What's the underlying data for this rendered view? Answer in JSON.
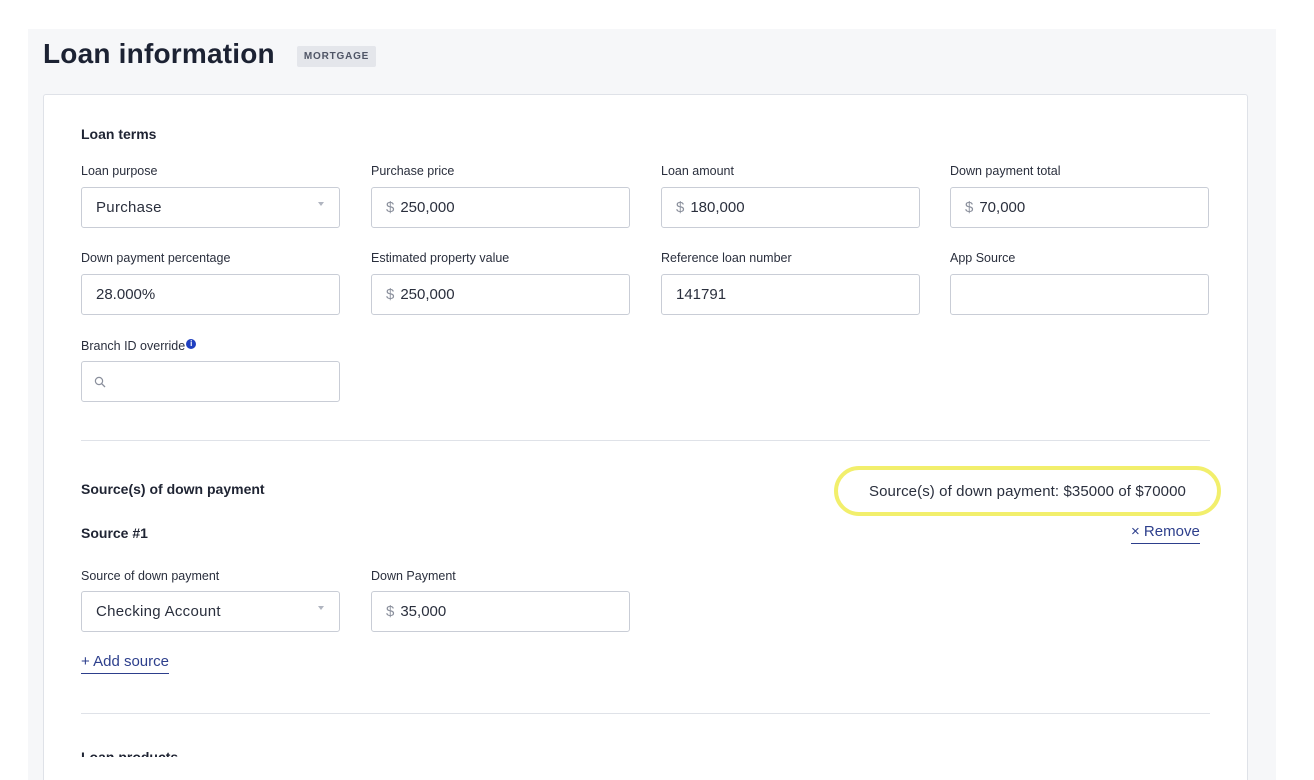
{
  "page": {
    "title": "Loan information",
    "badge": "MORTGAGE"
  },
  "loan_terms": {
    "heading": "Loan terms",
    "loan_purpose": {
      "label": "Loan purpose",
      "value": "Purchase"
    },
    "purchase_price": {
      "label": "Purchase price",
      "prefix": "$",
      "value": "250,000"
    },
    "loan_amount": {
      "label": "Loan amount",
      "prefix": "$",
      "value": "180,000"
    },
    "down_payment_total": {
      "label": "Down payment total",
      "prefix": "$",
      "value": "70,000"
    },
    "down_payment_percentage": {
      "label": "Down payment percentage",
      "value": "28.000%"
    },
    "estimated_property_value": {
      "label": "Estimated property value",
      "prefix": "$",
      "value": "250,000"
    },
    "reference_loan_number": {
      "label": "Reference loan number",
      "value": "141791"
    },
    "app_source": {
      "label": "App Source",
      "value": ""
    },
    "branch_id_override": {
      "label": "Branch ID override",
      "value": ""
    }
  },
  "down_payment_sources": {
    "heading": "Source(s) of down payment",
    "summary": "Source(s) of down payment: $35000 of $70000",
    "source_1": {
      "heading": "Source #1",
      "remove_label": "× Remove",
      "source_type": {
        "label": "Source of down payment",
        "value": "Checking Account"
      },
      "amount": {
        "label": "Down Payment",
        "prefix": "$",
        "value": "35,000"
      }
    },
    "add_source_label": "+ Add source"
  },
  "next_section": {
    "heading": "Loan products"
  },
  "colors": {
    "highlight": "#f2ef6c",
    "link": "#2d3f8c",
    "info_icon": "#1f3fbf"
  }
}
